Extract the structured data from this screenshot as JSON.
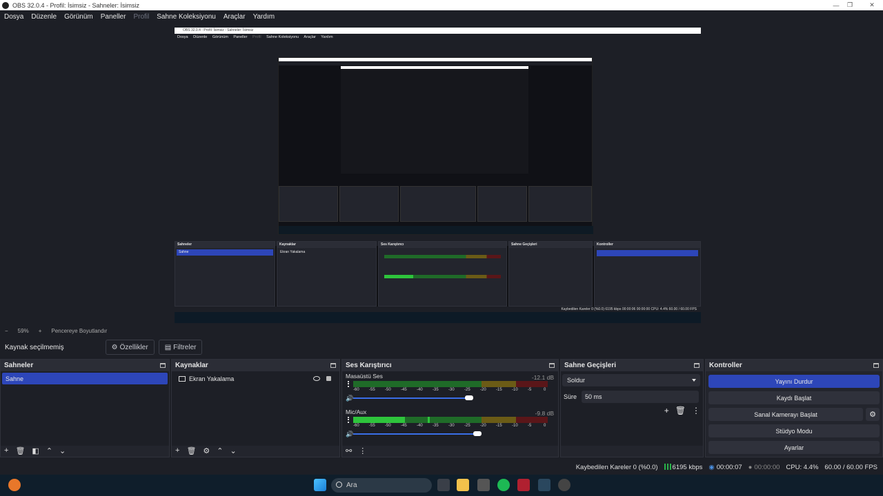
{
  "window": {
    "title": "OBS 32.0.4 - Profil: İsimsiz - Sahneler: İsimsiz"
  },
  "menu": [
    "Dosya",
    "Düzenle",
    "Görünüm",
    "Paneller",
    "Profil",
    "Sahne Koleksiyonu",
    "Araçlar",
    "Yardım"
  ],
  "preview": {
    "title": "OBS 32.0.4 - Profil: İsimsiz - Sahneler: İsimsiz",
    "menu": [
      "Dosya",
      "Düzenle",
      "Görünüm",
      "Paneller",
      "Profil",
      "Sahne Koleksiyonu",
      "Araçlar",
      "Yardım"
    ],
    "zoom": "59%",
    "fit": "Pencereye Boyutlandır",
    "no_source": "Kaynak seçilmemiş",
    "props": "Özellikler",
    "filters": "Filtreler",
    "scenes_title": "Sahneler",
    "scene": "Sahne",
    "sources_title": "Kaynaklar",
    "source": "Ekran Yakalama",
    "mixer_title": "Ses Karıştırıcı",
    "transitions_title": "Sahne Geçişleri",
    "controls_title": "Kontroller",
    "status": "Kaybedilen Kareler 0 (%0.0)   6195 kbps   00:00:06   00:00:00   CPU: 4.4%   60.00 / 60.00 FPS"
  },
  "zoombar": {
    "minus": "−",
    "zoom": "59%",
    "plus": "+",
    "fit": "Pencereye Boyutlandır"
  },
  "sourcebar": {
    "label": "Kaynak seçilmemiş",
    "props": "Özellikler",
    "filters": "Filtreler"
  },
  "scenes": {
    "title": "Sahneler",
    "items": [
      "Sahne"
    ]
  },
  "sources": {
    "title": "Kaynaklar",
    "items": [
      "Ekran Yakalama"
    ]
  },
  "mixer": {
    "title": "Ses Karıştırıcı",
    "channels": [
      {
        "name": "Masaüstü Ses",
        "db": "-12.1 dB",
        "level": 0.0,
        "volume": 0.62
      },
      {
        "name": "Mic/Aux",
        "db": "-9.8 dB",
        "level": 0.27,
        "volume": 0.65
      }
    ],
    "ticks": [
      "-60",
      "-55",
      "-50",
      "-45",
      "-40",
      "-35",
      "-30",
      "-25",
      "-20",
      "-15",
      "-10",
      "-5",
      "0"
    ]
  },
  "transitions": {
    "title": "Sahne Geçişleri",
    "selected": "Soldur",
    "duration_label": "Süre",
    "duration": "50 ms"
  },
  "controls": {
    "title": "Kontroller",
    "stop_stream": "Yayını Durdur",
    "start_record": "Kaydı Başlat",
    "virtual_cam": "Sanal Kamerayı Başlat",
    "studio": "Stüdyo Modu",
    "settings": "Ayarlar"
  },
  "status": {
    "dropped": "Kaybedilen Kareler 0 (%0.0)",
    "bitrate": "6195 kbps",
    "stream_time": "00:00:07",
    "rec_time": "00:00:00",
    "cpu": "CPU: 4.4%",
    "fps": "60.00 / 60.00 FPS"
  },
  "taskbar": {
    "search": "Ara"
  },
  "colors": {
    "accent": "#2d46b9",
    "bg": "#1d1f26",
    "panel": "#23252d",
    "meter_green": "#2ec43c",
    "meter_yellow": "#b59a1e",
    "meter_red": "#7a1e22"
  }
}
